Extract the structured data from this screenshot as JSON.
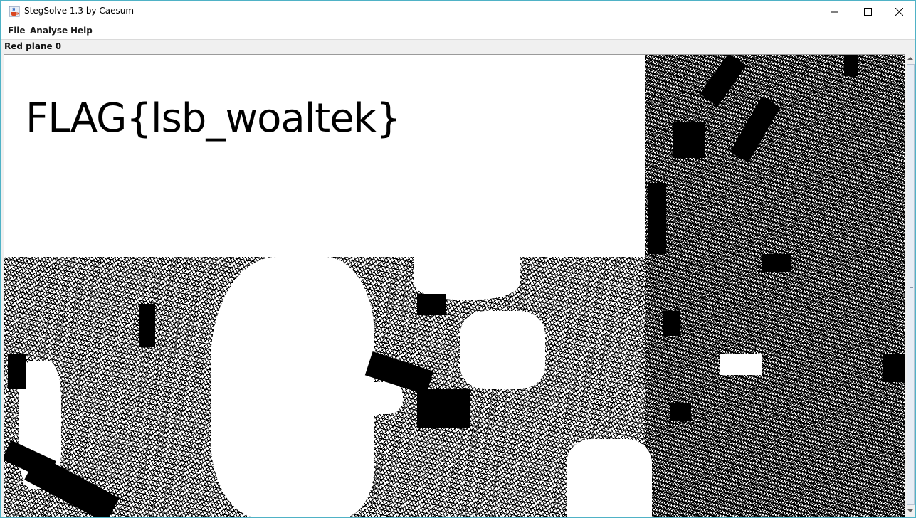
{
  "window": {
    "title": "StegSolve 1.3 by Caesum"
  },
  "menu": {
    "items": [
      "File",
      "Analyse",
      "Help"
    ]
  },
  "view": {
    "plane_label": "Red plane 0",
    "flag_text": "FLAG{lsb_woaltek}"
  },
  "icons": {
    "app": "java-coffee-cup-icon",
    "minimize": "minimize-icon",
    "maximize": "maximize-icon",
    "close": "close-icon"
  },
  "colors": {
    "window_border": "#4fb2c6",
    "image_fg": "#000000",
    "image_bg": "#ffffff"
  }
}
